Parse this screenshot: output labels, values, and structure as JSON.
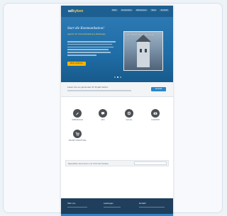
{
  "site": {
    "logo_prefix": "ad",
    "logo_suffix": "kyken",
    "nav": [
      "Start",
      "Kompetenz",
      "Referenzen",
      "Team",
      "Kontakt"
    ]
  },
  "hero": {
    "title": "Start die Kommunikation!",
    "subtitle": "Agentur für Online-Marketing & Webdesign",
    "button": "Mehr erfahren",
    "photo_caption": "Wir machen Städte lebendiger",
    "slide_count": 3,
    "active_slide": 1
  },
  "banner": {
    "text": "Lassen Sie uns gemeinsam Ihr Projekt starten",
    "button": "Kontakt"
  },
  "features": [
    {
      "label": "WEBDESIGN",
      "icon": "pen-icon"
    },
    {
      "label": "SEO",
      "icon": "chat-icon"
    },
    {
      "label": "SOCIAL",
      "icon": "gear-icon"
    },
    {
      "label": "CONTENT",
      "icon": "camera-icon"
    },
    {
      "label": "ONLINE MARKETING",
      "icon": "cart-icon"
    }
  ],
  "cta": {
    "text": "Newsletter abonnieren und informiert bleiben"
  },
  "footer": {
    "columns": [
      "Über uns",
      "Leistungen",
      "Kontakt"
    ]
  },
  "colors": {
    "brand": "#1e5f91",
    "accent": "#ffd34d",
    "button": "#2a86c9",
    "footer": "#1f3f5c"
  }
}
